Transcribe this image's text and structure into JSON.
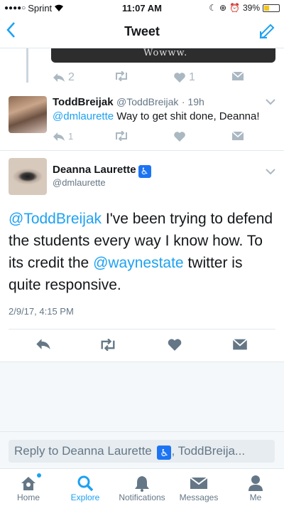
{
  "status_bar": {
    "carrier": "Sprint",
    "time": "11:07 AM",
    "battery": "39%",
    "battery_level": 0.39
  },
  "nav": {
    "title": "Tweet"
  },
  "previous_tweet": {
    "media_caption": "Wowww.",
    "actions": {
      "replies": "2",
      "retweets": "",
      "likes": "1"
    }
  },
  "reply_tweet": {
    "name": "ToddBreijak",
    "handle": "@ToddBreijak",
    "age": "· 19h",
    "mention": "@dmlaurette",
    "text": " Way to get shit done, Deanna!",
    "actions": {
      "replies": "1",
      "retweets": "",
      "likes": ""
    }
  },
  "main_tweet": {
    "name": "Deanna Laurette",
    "handle": "@dmlaurette",
    "text_part1_mention": "@ToddBreijak",
    "text_part2": " I've been trying to defend the students every way I know how. To its credit the ",
    "text_part3_mention": "@waynestate",
    "text_part4": " twitter is quite responsive.",
    "date": "2/9/17, 4:15 PM"
  },
  "reply_bar": {
    "prefix": "Reply to Deanna Laurette ",
    "suffix": ", ToddBreija..."
  },
  "tabs": [
    {
      "label": "Home",
      "icon": "home-icon"
    },
    {
      "label": "Explore",
      "icon": "search-icon",
      "active": true
    },
    {
      "label": "Notifications",
      "icon": "bell-icon"
    },
    {
      "label": "Messages",
      "icon": "envelope-icon"
    },
    {
      "label": "Me",
      "icon": "person-icon"
    }
  ],
  "colors": {
    "accent": "#1da1f2",
    "muted": "#657786",
    "icon_gray": "#aab8c2",
    "bg_gray": "#f5f8fa"
  }
}
